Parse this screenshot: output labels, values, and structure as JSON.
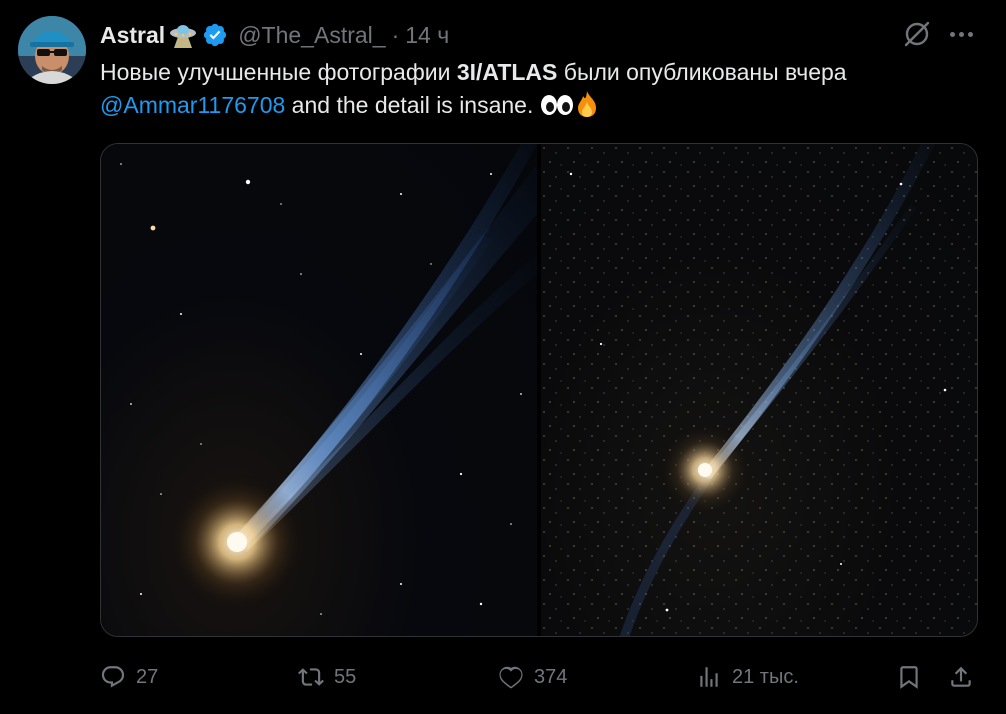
{
  "author": {
    "display_name": "Astral",
    "handle": "@The_Astral_",
    "separator": "·",
    "time": "14 ч"
  },
  "tweet": {
    "text_before": "Новые улучшенные фотографии ",
    "text_bold": "3I/ATLAS",
    "text_after": " были опубликованы вчера",
    "mention": "@Ammar1176708",
    "text_tail": " and the detail is insane. "
  },
  "media": {
    "photos": [
      {
        "subject": "comet 3I/ATLAS with long blue ion tail, left image"
      },
      {
        "subject": "comet 3I/ATLAS with thin blue tail on dense star field, right image"
      }
    ]
  },
  "actions": {
    "reply_count": "27",
    "retweet_count": "55",
    "like_count": "374",
    "views_count": "21 тыс."
  },
  "icons": [
    "ufo-emoji",
    "verified-badge-icon",
    "grok-icon",
    "more-icon",
    "eyes-emoji",
    "fire-emoji",
    "reply-icon",
    "retweet-icon",
    "like-icon",
    "views-icon",
    "bookmark-icon",
    "share-icon"
  ],
  "colors": {
    "background": "#000000",
    "text": "#e7e9ea",
    "muted": "#71767b",
    "accent": "#1d9bf0"
  }
}
